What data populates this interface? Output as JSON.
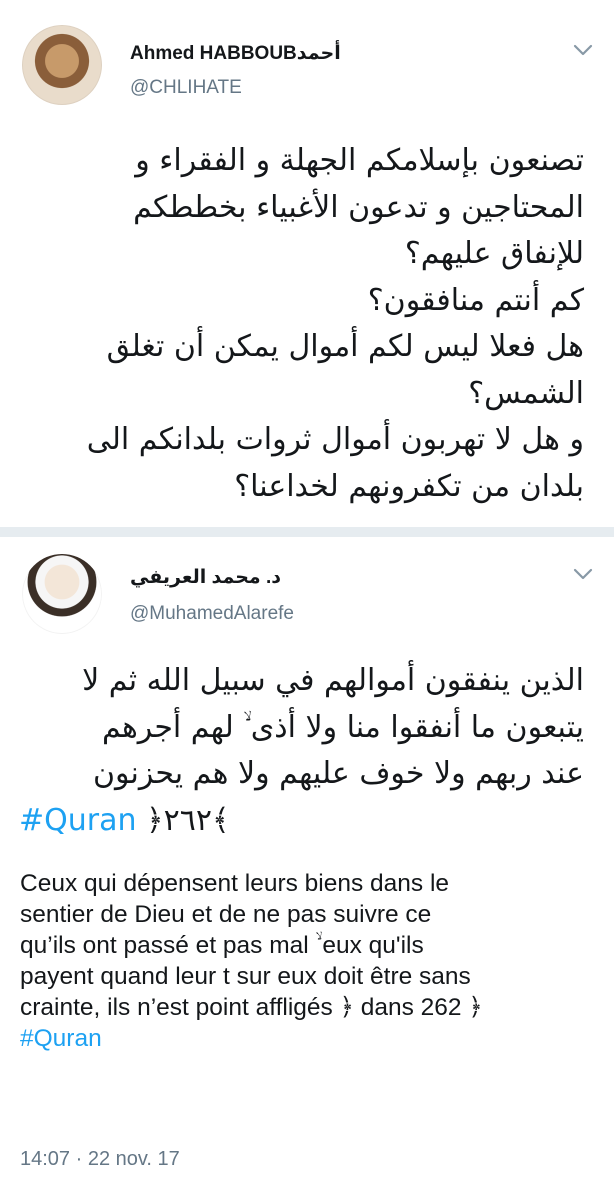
{
  "tweet1": {
    "name": "Ahmed HABBOUBأحمد",
    "handle": "@CHLIHATE",
    "lines": [
      "تصنعون بإسلامكم الجهلة و الفقراء و",
      "المحتاجين و تدعون الأغبياء بخططكم",
      "للإنفاق عليهم؟",
      "كم أنتم منافقون؟",
      "هل فعلا ليس لكم أموال يمكن أن تغلق",
      "الشمس؟",
      "و هل لا تهربون أموال ثروات بلدانكم الى",
      "بلدان من تكفرونهم لخداعنا؟"
    ]
  },
  "tweet2": {
    "name": "د. محمد العريفي",
    "handle": "@MuhamedAlarefe",
    "arabic_lines": [
      "الذين ينفقون أموالهم في سبيل الله ثم لا",
      "يتبعون ما أنفقوا منا ولا أذى ۙ لهم أجرهم",
      "عند ربهم ولا خوف عليهم ولا هم يحزنون"
    ],
    "arabic_hashtag": "#Quran",
    "arabic_verse_ref": "﴿٢٦٢﴾",
    "french_lines": [
      "Ceux qui dépensent leurs biens dans le",
      "sentier de Dieu et de ne pas suivre ce",
      "qu’ils ont passé et pas mal ۙ eux qu'ils",
      "payent quand leur t sur eux doit être sans",
      "crainte, ils n’est point affligés ﴿ dans 262 ﴿"
    ],
    "french_hashtag": "#Quran",
    "timestamp": "14:07 · 22 nov. 17"
  },
  "icons": {
    "tweet_menu": "chevron-down-icon"
  },
  "colors": {
    "link": "#1da1f2",
    "secondary_text": "#657786",
    "separator": "#e6ecf0"
  }
}
